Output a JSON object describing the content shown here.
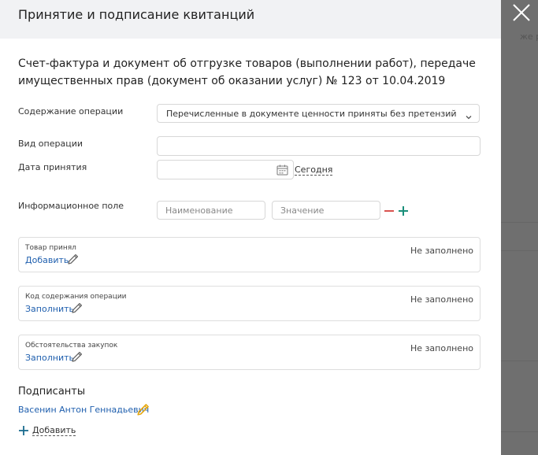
{
  "modal": {
    "title": "Принятие и подписание квитанций",
    "close_icon": "close-icon"
  },
  "backdrop": {
    "text": "же раз"
  },
  "document": {
    "title": "Счет-фактура и документ об отгрузке товаров (выполнении работ), передаче имущественных прав (документ об оказании услуг) № 123 от 10.04.2019"
  },
  "form": {
    "operation_content": {
      "label": "Содержание операции",
      "value": "Перечисленные в документе ценности приняты без претензий"
    },
    "operation_type": {
      "label": "Вид операции",
      "value": ""
    },
    "acceptance_date": {
      "label": "Дата принятия",
      "value": "",
      "today_link": "Сегодня"
    },
    "info_field": {
      "label": "Информационное поле",
      "name_placeholder": "Наименование",
      "value_placeholder": "Значение"
    }
  },
  "cards": [
    {
      "label": "Товар принял",
      "link": "Добавить",
      "status": "Не заполнено"
    },
    {
      "label": "Код содержания операции",
      "link": "Заполнить",
      "status": "Не заполнено"
    },
    {
      "label": "Обстоятельства закупок",
      "link": "Заполнить",
      "status": "Не заполнено"
    }
  ],
  "signers": {
    "title": "Подписанты",
    "items": [
      {
        "name": "Васенин Антон Геннадьевич"
      }
    ],
    "add_label": "Добавить"
  },
  "colors": {
    "accent_link": "#1f5fae",
    "minus": "#d9534f",
    "plus": "#1a8f7a",
    "signer_pencil": "#e5a50a"
  }
}
